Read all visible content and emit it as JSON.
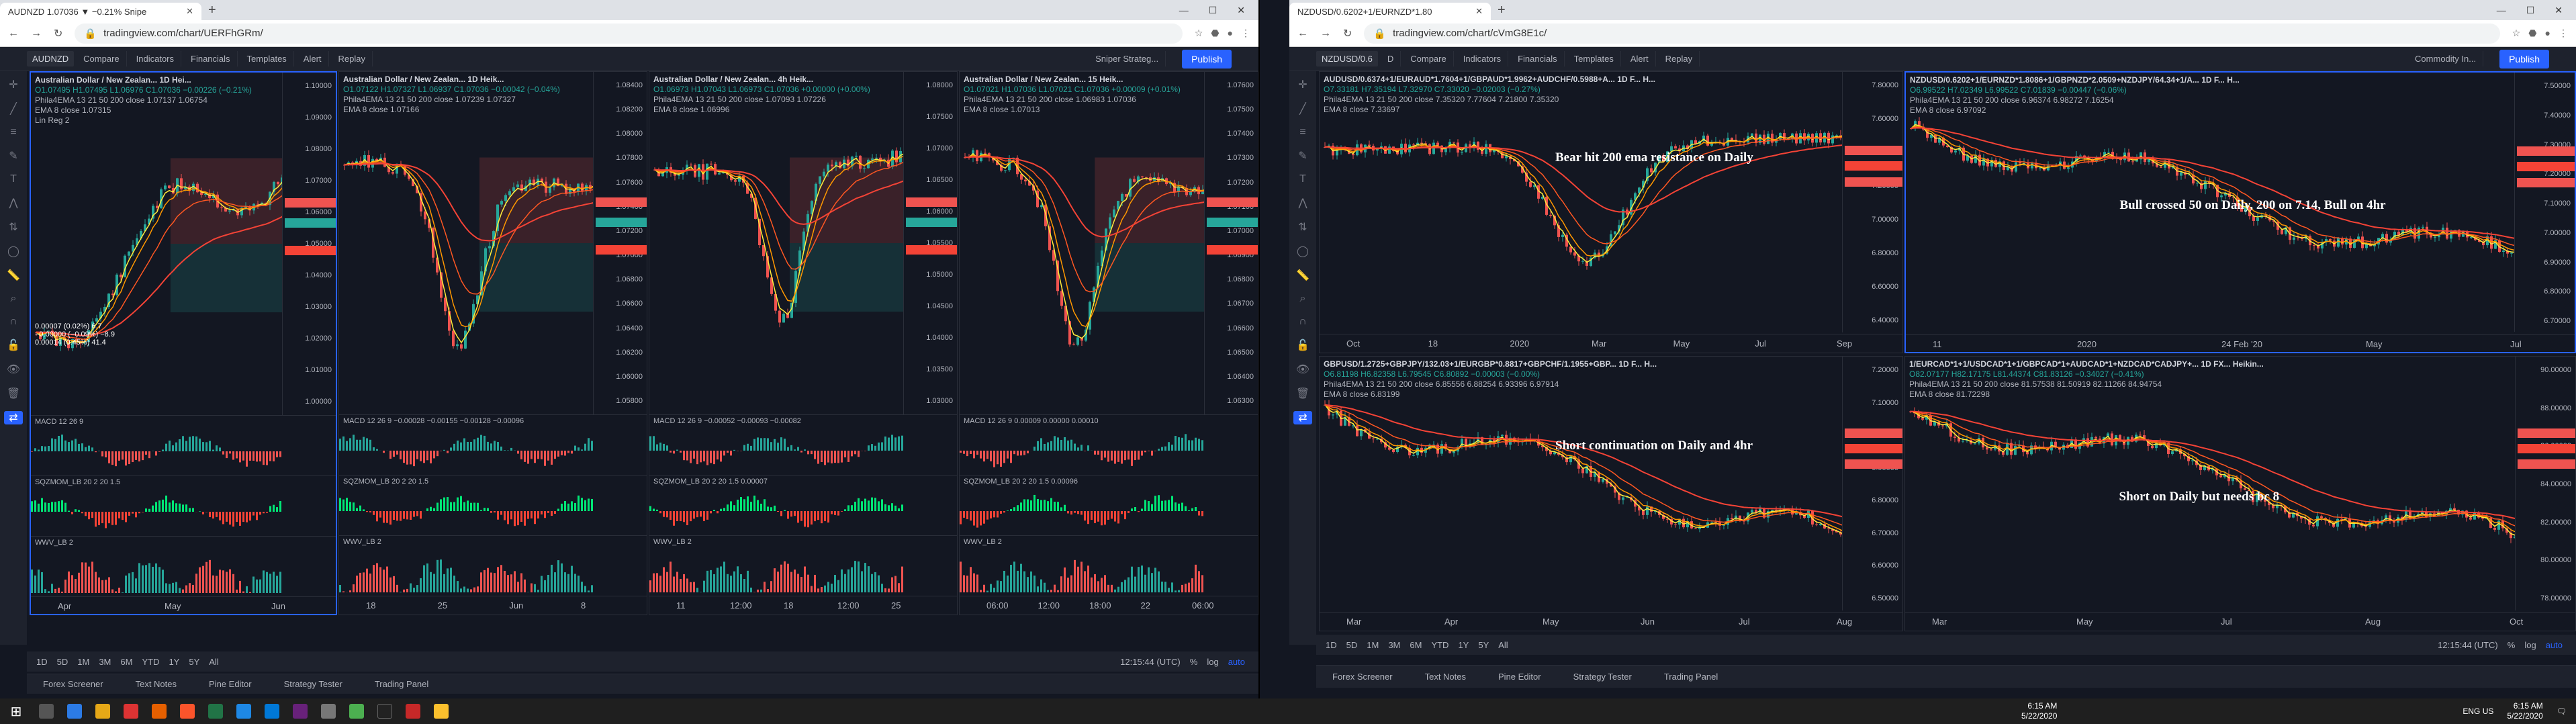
{
  "left": {
    "tab_title": "AUDNZD 1.07036 ▼ −0.21% Snipe",
    "url": "tradingview.com/chart/UERFhGRm/",
    "symbol": "AUDNZD",
    "toolbar": [
      "Compare",
      "Indicators",
      "Financials",
      "Templates",
      "Alert",
      "Replay"
    ],
    "template_name": "Sniper Strateg...",
    "publish": "Publish",
    "panes": [
      {
        "title": "Australian Dollar / New Zealan... 1D Hei...",
        "ohlc": "O1.07495 H1.07495 L1.06976 C1.07036 −0.00226 (−0.21%)",
        "ind1": "Phila4EMA 13 21 50 200 close 1.07137 1.06754",
        "ind2": "EMA 8 close 1.07315",
        "ind3": "Lin Reg 2",
        "ticks": [
          "1.10000",
          "1.09000",
          "1.08000",
          "1.07000",
          "1.06000",
          "1.05000",
          "1.04000",
          "1.03000",
          "1.02000",
          "1.01000",
          "1.00000"
        ],
        "macd": "MACD 12 26 9",
        "sqz": "SQZMOM_LB 20 2 20 1.5",
        "wwv": "WWV_LB 2",
        "xlabels": [
          "Apr",
          "May",
          "Jun"
        ],
        "linreg1": "0.00007 (0.02%) 6.7",
        "linreg2": "−0.00000 (−0.09%) −8.9",
        "linreg3": "0.00014 (0.45%) 41.4"
      },
      {
        "title": "Australian Dollar / New Zealan... 1D Heik...",
        "ohlc": "O1.07122 H1.07327 L1.06937 C1.07036 −0.00042 (−0.04%)",
        "ind1": "Phila4EMA 13 21 50 200 close 1.07239 1.07327",
        "ind2": "EMA 8 close 1.07166",
        "ind3": "",
        "ticks": [
          "1.08400",
          "1.08200",
          "1.08000",
          "1.07800",
          "1.07600",
          "1.07400",
          "1.07200",
          "1.07000",
          "1.06800",
          "1.06600",
          "1.06400",
          "1.06200",
          "1.06000",
          "1.05800"
        ],
        "macd": "MACD 12 26 9 −0.00028 −0.00155 −0.00128 −0.00096",
        "sqz": "SQZMOM_LB 20 2 20 1.5",
        "wwv": "WWV_LB 2",
        "xlabels": [
          "18",
          "25",
          "Jun",
          "8"
        ]
      },
      {
        "title": "Australian Dollar / New Zealan... 4h Heik...",
        "ohlc": "O1.06973 H1.07043 L1.06973 C1.07036 +0.00000 (+0.00%)",
        "ind1": "Phila4EMA 13 21 50 200 close 1.07093 1.07226",
        "ind2": "EMA 8 close 1.06996",
        "ind3": "",
        "ticks": [
          "1.08000",
          "1.07500",
          "1.07000",
          "1.06500",
          "1.06000",
          "1.05500",
          "1.05000",
          "1.04500",
          "1.04000",
          "1.03500",
          "1.03000"
        ],
        "macd": "MACD 12 26 9 −0.00052 −0.00093 −0.00082",
        "sqz": "SQZMOM_LB 20 2 20 1.5 0.00007",
        "wwv": "WWV_LB 2",
        "xlabels": [
          "11",
          "12:00",
          "18",
          "12:00",
          "25"
        ]
      },
      {
        "title": "Australian Dollar / New Zealan... 15 Heik...",
        "ohlc": "O1.07021 H1.07036 L1.07021 C1.07036 +0.00009 (+0.01%)",
        "ind1": "Phila4EMA 13 21 50 200 close 1.06983 1.07036",
        "ind2": "EMA 8 close 1.07013",
        "ind3": "",
        "ticks": [
          "1.07600",
          "1.07500",
          "1.07400",
          "1.07300",
          "1.07200",
          "1.07100",
          "1.07000",
          "1.06900",
          "1.06800",
          "1.06700",
          "1.06600",
          "1.06500",
          "1.06400",
          "1.06300"
        ],
        "macd": "MACD 12 26 9 0.00009 0.00000 0.00010",
        "sqz": "SQZMOM_LB 20 2 20 1.5 0.00096",
        "wwv": "WWV_LB 2",
        "xlabels": [
          "06:00",
          "12:00",
          "18:00",
          "22",
          "06:00"
        ]
      }
    ],
    "ranges": [
      "1D",
      "5D",
      "1M",
      "3M",
      "6M",
      "YTD",
      "1Y",
      "5Y",
      "All"
    ],
    "time": "12:15:44 (UTC)",
    "scale": [
      "%",
      "log",
      "auto"
    ],
    "panel_tabs": [
      "Forex Screener",
      "Text Notes",
      "Pine Editor",
      "Strategy Tester",
      "Trading Panel"
    ]
  },
  "right": {
    "tab_title": "NZDUSD/0.6202+1/EURNZD*1.80",
    "url": "tradingview.com/chart/cVmG8E1c/",
    "symbol": "NZDUSD/0.6",
    "toolbar": [
      "Compare",
      "Indicators",
      "Financials",
      "Templates",
      "Alert",
      "Replay"
    ],
    "template_name": "Commodity In...",
    "publish": "Publish",
    "panes": [
      {
        "title": "AUDUSD/0.6374+1/EURAUD*1.7604+1/GBPAUD*1.9962+AUDCHF/0.5988+A... 1D F... H...",
        "ohlc": "O7.33181 H7.35194 L7.32970 C7.33020 −0.02003 (−0.27%)",
        "ind1": "Phila4EMA 13 21 50 200 close 7.35320 7.77604 7.21800 7.35320",
        "ind2": "EMA 8 close 7.33697",
        "ticks": [
          "7.80000",
          "7.60000",
          "7.40000",
          "7.20000",
          "7.00000",
          "6.80000",
          "6.60000",
          "6.40000"
        ],
        "annotation": "Bear hit 200 ema resistance on Daily",
        "xlabels": [
          "Oct",
          "18",
          "2020",
          "Mar",
          "May",
          "Jul",
          "Sep"
        ]
      },
      {
        "title": "NZDUSD/0.6202+1/EURNZD*1.8086+1/GBPNZD*2.0509+NZDJPY/64.34+1/A... 1D F... H...",
        "ohlc": "O6.99522 H7.02349 L6.99522 C7.01839 −0.00447 (−0.06%)",
        "ind1": "Phila4EMA 13 21 50 200 close 6.96374 6.98272 7.16254",
        "ind2": "EMA 8 close 6.97092",
        "ticks": [
          "7.50000",
          "7.40000",
          "7.30000",
          "7.20000",
          "7.10000",
          "7.00000",
          "6.90000",
          "6.80000",
          "6.70000"
        ],
        "annotation": "Bull crossed 50 on Daily, 200 on 7.14, Bull on 4hr",
        "xlabels": [
          "11",
          "2020",
          "24 Feb '20",
          "May",
          "Jul"
        ]
      },
      {
        "title": "GBPUSD/1.2725+GBPJPY/132.03+1/EURGBP*0.8817+GBPCHF/1.1955+GBP... 1D F... H...",
        "ohlc": "O6.81198 H6.82358 L6.79545 C6.80892 −0.00003 (−0.00%)",
        "ind1": "Phila4EMA 13 21 50 200 close 6.85556 6.88254 6.93396 6.97914",
        "ind2": "EMA 8 close 6.83199",
        "ticks": [
          "7.20000",
          "7.10000",
          "7.00000",
          "6.90000",
          "6.80000",
          "6.70000",
          "6.60000",
          "6.50000"
        ],
        "annotation": "Short continuation on Daily and 4hr",
        "xlabels": [
          "Mar",
          "Apr",
          "May",
          "Jun",
          "Jul",
          "Aug"
        ]
      },
      {
        "title": "1/EURCAD*1+1/USDCAD*1+1/GBPCAD*1+AUDCAD*1+NZDCAD*CADJPY+... 1D FX... Heikin...",
        "ohlc": "O82.07177 H82.17175 L81.44374 C81.83126 −0.34027 (−0.41%)",
        "ind1": "Phila4EMA 13 21 50 200 close 81.57538 81.50919 82.11266 84.94754",
        "ind2": "EMA 8 close 81.72298",
        "ticks": [
          "90.00000",
          "88.00000",
          "86.00000",
          "84.00000",
          "82.00000",
          "80.00000",
          "78.00000"
        ],
        "annotation": "Short on Daily but needs bc 8",
        "xlabels": [
          "Mar",
          "May",
          "Jul",
          "Aug",
          "Oct"
        ]
      }
    ],
    "ranges": [
      "1D",
      "5D",
      "1M",
      "3M",
      "6M",
      "YTD",
      "1Y",
      "5Y",
      "All"
    ],
    "time": "12:15:44 (UTC)",
    "scale": [
      "%",
      "log",
      "auto"
    ],
    "panel_tabs": [
      "Forex Screener",
      "Text Notes",
      "Pine Editor",
      "Strategy Tester",
      "Trading Panel"
    ]
  },
  "taskbar": {
    "time_left": "6:15 AM",
    "date_left": "5/22/2020",
    "lang": "ENG US",
    "time_right": "6:15 AM",
    "date_right": "5/22/2020"
  },
  "colors": {
    "up": "#26a69a",
    "down": "#ef5350",
    "ema13": "#ffeb3b",
    "ema21": "#ff9800",
    "ema50": "#ff5722",
    "ema200": "#f44336",
    "accent": "#2962ff"
  }
}
